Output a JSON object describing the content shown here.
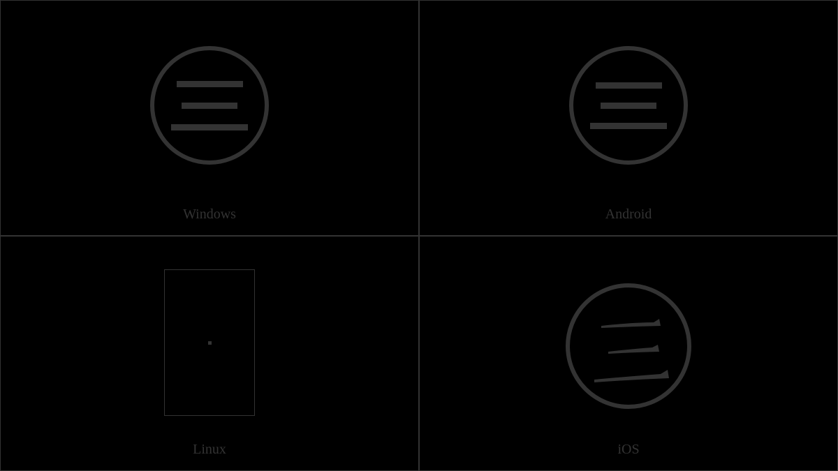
{
  "cells": [
    {
      "label": "Windows"
    },
    {
      "label": "Android"
    },
    {
      "label": "Linux"
    },
    {
      "label": "iOS"
    }
  ]
}
